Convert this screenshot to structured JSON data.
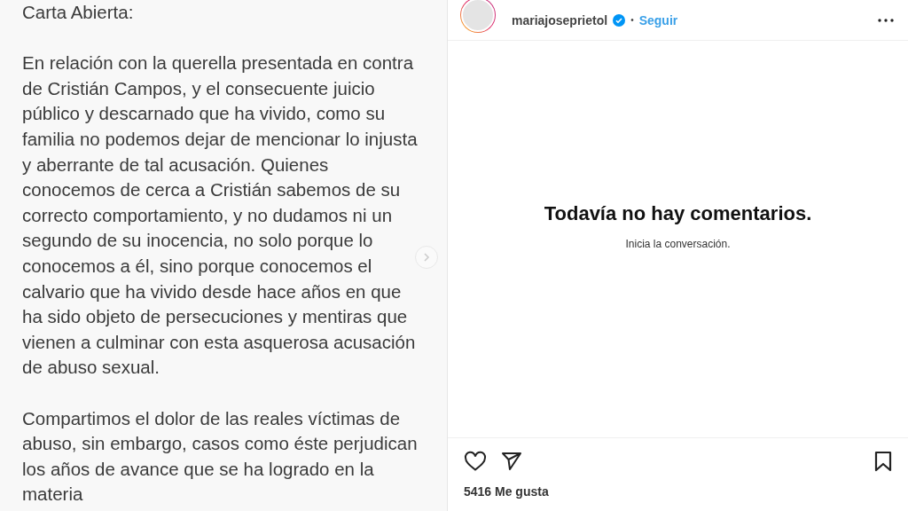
{
  "post_image": {
    "title": "Carta Abierta:",
    "paragraphs": [
      [
        "En relación con la querella presentada en contra",
        "de Cristián Campos, y el consecuente juicio",
        "público y descarnado que ha vivido, como su",
        "familia no podemos dejar de mencionar lo injusta",
        "y aberrante de tal acusación. Quienes",
        "conocemos de cerca a Cristián sabemos de su",
        "correcto comportamiento, y no dudamos ni un",
        "segundo de su inocencia, no solo porque lo",
        "conocemos a él, sino porque conocemos el",
        "calvario que ha vivido desde hace años en que",
        "ha sido objeto de persecuciones y mentiras que",
        "vienen a culminar con esta asquerosa acusación",
        "de abuso sexual."
      ],
      [
        "Compartimos el dolor de las reales víctimas de",
        "abuso, sin embargo, casos como éste perjudican",
        "los años de avance que se ha logrado en la",
        "materia"
      ]
    ]
  },
  "header": {
    "username": "mariajoseprietol",
    "verified": true,
    "separator": "•",
    "follow": "Seguir"
  },
  "comments": {
    "empty_title": "Todavía no hay comentarios.",
    "empty_subtitle": "Inicia la conversación."
  },
  "likes": "5416 Me gusta"
}
